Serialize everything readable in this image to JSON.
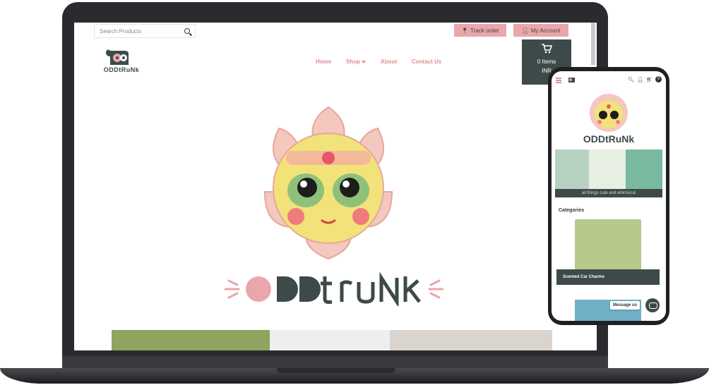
{
  "site": {
    "search_placeholder": "Search Products",
    "track_order_label": "Track order",
    "my_account_label": "My Account",
    "nav": [
      "Home",
      "Shop",
      "About",
      "Contact Us"
    ],
    "cart_items_label": "0 Items",
    "cart_currency_label": "INR",
    "brand_wordmark": "ODDtRuNk",
    "brand_wordmark_small": "ODDtRuNk",
    "accent_color": "#e9a7ab",
    "dark_color": "#3e4a4a"
  },
  "mobile": {
    "cart_count": "0",
    "brand_wordmark": "ODDtRuNk",
    "banner_caption": "all things cute and whimsical",
    "categories_heading": "Categories",
    "category_label": "Scented Car Charms",
    "message_label": "Message us"
  }
}
